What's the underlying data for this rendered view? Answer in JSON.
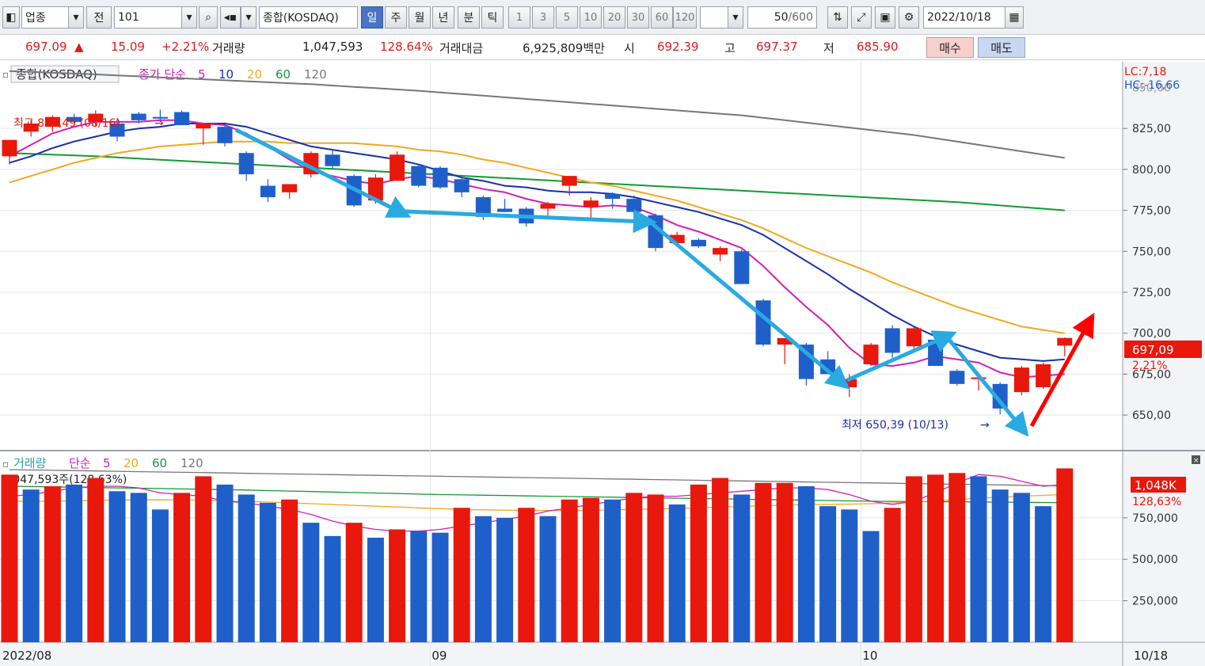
{
  "toolbar": {
    "category": "업종",
    "prev_label": "전",
    "code": "101",
    "index_name": "종합(KOSDAQ)",
    "period_tabs": [
      "일",
      "주",
      "월",
      "년",
      "분",
      "틱"
    ],
    "active_tab": "일",
    "intervals": [
      "1",
      "3",
      "5",
      "10",
      "20",
      "30",
      "60",
      "120"
    ],
    "count": "50",
    "count_max": "/600",
    "date": "2022/10/18"
  },
  "info": {
    "price": "697.09",
    "change_arrow": "▲",
    "change": "15.09",
    "change_pct": "+2.21%",
    "volume_label": "거래량",
    "volume": "1,047,593",
    "volume_pct": "128.64%",
    "amount_label": "거래대금",
    "amount": "6,925,809백만",
    "open_label": "시",
    "open": "692.39",
    "high_label": "고",
    "high": "697.37",
    "low_label": "저",
    "low": "685.90",
    "buy_label": "매수",
    "sell_label": "매도"
  },
  "chart_data": [
    {
      "type": "candlestick",
      "title": "종합(KOSDAQ)",
      "legend": {
        "prefix": "종가 단순",
        "periods": [
          "5",
          "10",
          "20",
          "60",
          "120"
        ],
        "colors": [
          "#d21fb4",
          "#1a2fa8",
          "#f0a91e",
          "#139a35",
          "#777777"
        ]
      },
      "ylim": [
        637,
        857
      ],
      "y_ticks": [
        "825,00",
        "800,00",
        "775,00",
        "750,00",
        "725,00",
        "700,00",
        "675,00",
        "650,00"
      ],
      "y_tick_values": [
        825,
        800,
        775,
        750,
        725,
        700,
        675,
        650
      ],
      "top_tick_partial": "850,00",
      "x_labels": [
        {
          "label": "2022/08",
          "index": 0
        },
        {
          "label": "09",
          "index": 20
        },
        {
          "label": "10",
          "index": 40
        }
      ],
      "last_date_label": "10/18",
      "lc": "LC:7,18",
      "hc": "HC:-16,66",
      "price_tag": "697,09",
      "pct_tag": "2,21%",
      "high_annotation": "최고 836,49 (08/16)",
      "low_annotation": "최저 650,39 (10/13)",
      "candles": [
        {
          "o": 808,
          "h": 811,
          "l": 803,
          "c": 818,
          "up": true
        },
        {
          "o": 823,
          "h": 830,
          "l": 820,
          "c": 828,
          "up": true
        },
        {
          "o": 826,
          "h": 833,
          "l": 823,
          "c": 832,
          "up": true
        },
        {
          "o": 832,
          "h": 834,
          "l": 829,
          "c": 829,
          "up": false
        },
        {
          "o": 829,
          "h": 836,
          "l": 826,
          "c": 834,
          "up": true
        },
        {
          "o": 828,
          "h": 831,
          "l": 817,
          "c": 820,
          "up": false
        },
        {
          "o": 834,
          "h": 835,
          "l": 828,
          "c": 830,
          "up": false
        },
        {
          "o": 832,
          "h": 836.5,
          "l": 829,
          "c": 831,
          "up": false
        },
        {
          "o": 835,
          "h": 836,
          "l": 827,
          "c": 827,
          "up": false
        },
        {
          "o": 825,
          "h": 828,
          "l": 815,
          "c": 828,
          "up": true
        },
        {
          "o": 826,
          "h": 827,
          "l": 814,
          "c": 816,
          "up": false
        },
        {
          "o": 810,
          "h": 811,
          "l": 793,
          "c": 797,
          "up": false
        },
        {
          "o": 790,
          "h": 794,
          "l": 780,
          "c": 783,
          "up": false
        },
        {
          "o": 786,
          "h": 791,
          "l": 782,
          "c": 791,
          "up": true
        },
        {
          "o": 797,
          "h": 811,
          "l": 795,
          "c": 810,
          "up": true
        },
        {
          "o": 809,
          "h": 812,
          "l": 800,
          "c": 802,
          "up": false
        },
        {
          "o": 796,
          "h": 797,
          "l": 777,
          "c": 778,
          "up": false
        },
        {
          "o": 781,
          "h": 797,
          "l": 779,
          "c": 795,
          "up": true
        },
        {
          "o": 793,
          "h": 811,
          "l": 793,
          "c": 809,
          "up": true
        },
        {
          "o": 802,
          "h": 803,
          "l": 789,
          "c": 790,
          "up": false
        },
        {
          "o": 801,
          "h": 802,
          "l": 788,
          "c": 789,
          "up": false
        },
        {
          "o": 794,
          "h": 795,
          "l": 783,
          "c": 786,
          "up": false
        },
        {
          "o": 783,
          "h": 784,
          "l": 769,
          "c": 771,
          "up": false
        },
        {
          "o": 776,
          "h": 782,
          "l": 774,
          "c": 774,
          "up": false
        },
        {
          "o": 776,
          "h": 777,
          "l": 765,
          "c": 767,
          "up": false
        },
        {
          "o": 776,
          "h": 780,
          "l": 770,
          "c": 779,
          "up": true
        },
        {
          "o": 790,
          "h": 791,
          "l": 784,
          "c": 796,
          "up": true
        },
        {
          "o": 777,
          "h": 783,
          "l": 769,
          "c": 781,
          "up": true
        },
        {
          "o": 782,
          "h": 786,
          "l": 776,
          "c": 785,
          "up": false
        },
        {
          "o": 782,
          "h": 784,
          "l": 770,
          "c": 774,
          "up": false
        },
        {
          "o": 772,
          "h": 773,
          "l": 750,
          "c": 752,
          "up": false
        },
        {
          "o": 760,
          "h": 762,
          "l": 755,
          "c": 755,
          "up": true
        },
        {
          "o": 757,
          "h": 758,
          "l": 752,
          "c": 753,
          "up": false
        },
        {
          "o": 748,
          "h": 753,
          "l": 744,
          "c": 752,
          "up": true
        },
        {
          "o": 750,
          "h": 751,
          "l": 730,
          "c": 730,
          "up": false
        },
        {
          "o": 720,
          "h": 721,
          "l": 692,
          "c": 693,
          "up": false
        },
        {
          "o": 693,
          "h": 697,
          "l": 681,
          "c": 697,
          "up": true
        },
        {
          "o": 693,
          "h": 694,
          "l": 668,
          "c": 672,
          "up": false
        },
        {
          "o": 684,
          "h": 689,
          "l": 675,
          "c": 675,
          "up": false
        },
        {
          "o": 667,
          "h": 675,
          "l": 661,
          "c": 672,
          "up": true
        },
        {
          "o": 681,
          "h": 694,
          "l": 680,
          "c": 693,
          "up": true
        },
        {
          "o": 703,
          "h": 705,
          "l": 685,
          "c": 688,
          "up": false
        },
        {
          "o": 692,
          "h": 704,
          "l": 688,
          "c": 703,
          "up": true
        },
        {
          "o": 696,
          "h": 697,
          "l": 680,
          "c": 680,
          "up": false
        },
        {
          "o": 677,
          "h": 678,
          "l": 668,
          "c": 669,
          "up": false
        },
        {
          "o": 672,
          "h": 675,
          "l": 665,
          "c": 673,
          "up": true
        },
        {
          "o": 669,
          "h": 670,
          "l": 650.4,
          "c": 654,
          "up": false
        },
        {
          "o": 664,
          "h": 680,
          "l": 662,
          "c": 679,
          "up": true
        },
        {
          "o": 667,
          "h": 682,
          "l": 666,
          "c": 681,
          "up": true
        },
        {
          "o": 692.39,
          "h": 697.37,
          "l": 685.9,
          "c": 697.09,
          "up": true
        }
      ],
      "ma5": [
        808,
        815,
        822,
        826,
        829,
        829,
        829,
        830,
        830,
        828,
        827,
        822,
        814,
        806,
        799,
        796,
        793,
        791,
        794,
        796,
        794,
        791,
        788,
        786,
        782,
        779,
        778,
        777,
        778,
        777,
        772,
        766,
        762,
        757,
        752,
        741,
        728,
        716,
        705,
        691,
        681,
        680,
        682,
        686,
        684,
        682,
        676,
        673,
        674,
        675
      ],
      "ma10": [
        804,
        808,
        813,
        817,
        820,
        823,
        825,
        826,
        828,
        828,
        828,
        826,
        822,
        818,
        814,
        812,
        810,
        808,
        806,
        803,
        799,
        795,
        793,
        790,
        789,
        787,
        786,
        786,
        785,
        783,
        780,
        777,
        774,
        770,
        766,
        760,
        752,
        744,
        736,
        727,
        719,
        711,
        704,
        698,
        693,
        689,
        685,
        684,
        683,
        684
      ],
      "ma20": [
        792,
        796,
        800,
        804,
        807,
        810,
        812,
        814,
        815,
        816,
        817,
        817,
        817,
        816,
        816,
        816,
        816,
        815,
        814,
        812,
        811,
        809,
        806,
        804,
        801,
        798,
        795,
        792,
        790,
        787,
        784,
        781,
        777,
        773,
        769,
        764,
        758,
        752,
        747,
        742,
        737,
        731,
        726,
        721,
        716,
        712,
        708,
        704,
        702,
        700
      ],
      "ma60": [
        810,
        809.5,
        809,
        808.5,
        808,
        807.3,
        806.6,
        805.9,
        805.2,
        804.5,
        803.8,
        803.1,
        802.4,
        801.7,
        801,
        800.3,
        799.6,
        798.9,
        798.2,
        797.5,
        796.8,
        796.1,
        795.4,
        794.7,
        794,
        793.3,
        792.6,
        791.9,
        791.2,
        790.5,
        789.8,
        789.1,
        788.4,
        787.7,
        787,
        786.3,
        785.6,
        784.9,
        784.2,
        783.5,
        782.8,
        782.1,
        781.4,
        780.7,
        780,
        779,
        778,
        777,
        776,
        775
      ],
      "ma120": [
        860,
        859.5,
        859,
        858.5,
        858,
        857.4,
        856.8,
        856.2,
        855.6,
        855,
        854.4,
        853.8,
        853.2,
        852.6,
        852,
        851.2,
        850.4,
        849.6,
        848.8,
        848,
        847,
        846,
        845,
        844,
        843,
        842,
        841,
        840,
        839,
        838,
        837,
        836,
        835,
        834,
        833,
        831.5,
        830,
        828.5,
        827,
        825.5,
        824,
        822.5,
        821,
        819,
        817,
        815,
        813,
        811,
        809,
        807
      ]
    },
    {
      "type": "bar",
      "title": "거래량",
      "legend": {
        "prefix": "단순",
        "periods": [
          "5",
          "20",
          "60",
          "120"
        ],
        "colors": [
          "#d21fb4",
          "#f0a91e",
          "#139a35",
          "#777777"
        ]
      },
      "current_label": "1,047,593주(128,63%)",
      "ylim": [
        0,
        1150000
      ],
      "y_ticks": [
        "750,000",
        "500,000",
        "250,000"
      ],
      "y_tick_values": [
        750000,
        500000,
        250000
      ],
      "vol_tag": "1,048K",
      "vol_pct_tag": "128,63%",
      "values": [
        1010000,
        920000,
        940000,
        950000,
        990000,
        910000,
        900000,
        800000,
        900000,
        1000000,
        950000,
        890000,
        840000,
        860000,
        720000,
        640000,
        720000,
        630000,
        680000,
        670000,
        660000,
        810000,
        760000,
        750000,
        810000,
        760000,
        860000,
        870000,
        860000,
        900000,
        890000,
        830000,
        950000,
        990000,
        890000,
        960000,
        960000,
        940000,
        820000,
        800000,
        670000,
        810000,
        1000000,
        1010000,
        1020000,
        1000000,
        920000,
        900000,
        820000,
        1047593
      ],
      "up": [
        true,
        false,
        true,
        false,
        true,
        false,
        false,
        false,
        true,
        true,
        false,
        false,
        false,
        true,
        false,
        false,
        true,
        false,
        true,
        false,
        false,
        true,
        false,
        false,
        true,
        false,
        true,
        true,
        false,
        true,
        true,
        false,
        true,
        true,
        false,
        true,
        true,
        false,
        false,
        false,
        false,
        true,
        true,
        true,
        true,
        false,
        false,
        false,
        false,
        true
      ],
      "ma5": [
        880000,
        890000,
        910000,
        930000,
        940000,
        940000,
        930000,
        900000,
        890000,
        880000,
        850000,
        840000,
        820000,
        800000,
        770000,
        730000,
        700000,
        680000,
        670000,
        670000,
        680000,
        700000,
        720000,
        740000,
        760000,
        790000,
        810000,
        830000,
        850000,
        870000,
        880000,
        880000,
        890000,
        900000,
        910000,
        920000,
        930000,
        930000,
        920000,
        890000,
        850000,
        830000,
        850000,
        900000,
        960000,
        1010000,
        1000000,
        970000,
        940000,
        950000
      ],
      "ma20": [
        850000,
        850000,
        850000,
        852000,
        855000,
        857000,
        858000,
        858000,
        857000,
        855000,
        852000,
        848000,
        845000,
        840000,
        835000,
        830000,
        825000,
        820000,
        815000,
        810000,
        805000,
        800000,
        798000,
        796000,
        795000,
        794000,
        794000,
        795000,
        797000,
        800000,
        803000,
        806000,
        810000,
        815000,
        818000,
        822000,
        826000,
        830000,
        830000,
        832000,
        835000,
        840000,
        845000,
        852000,
        860000,
        868000,
        874000,
        880000,
        885000,
        890000
      ],
      "ma60": [
        940000,
        938000,
        936000,
        934000,
        932000,
        930000,
        928000,
        926000,
        924000,
        922000,
        920000,
        917000,
        914000,
        911000,
        908000,
        905000,
        902000,
        899000,
        896000,
        893000,
        890000,
        888000,
        886000,
        884000,
        882000,
        880000,
        878000,
        876000,
        874000,
        872000,
        870000,
        868000,
        866000,
        864000,
        862000,
        860000,
        858000,
        856000,
        854000,
        852000,
        850000,
        849000,
        848000,
        847000,
        846000,
        845000,
        844000,
        843000,
        842000,
        841000
      ],
      "ma120": [
        1040000,
        1038000,
        1036000,
        1034000,
        1032000,
        1030000,
        1028000,
        1026000,
        1024000,
        1022000,
        1020000,
        1018000,
        1016000,
        1014000,
        1012000,
        1010000,
        1008000,
        1006000,
        1004000,
        1002000,
        1000000,
        998000,
        996000,
        994000,
        992000,
        990000,
        988000,
        986000,
        984000,
        982000,
        980000,
        978000,
        976000,
        974000,
        972000,
        970000,
        968000,
        966000,
        964000,
        962000,
        960000,
        958000,
        956000,
        954000,
        952000,
        950000,
        948000,
        946000,
        944000,
        942000
      ]
    }
  ],
  "colors": {
    "up": "#e8180c",
    "down": "#1f5fc9",
    "annotation_arrow": "#29aae1",
    "up_arrow": "#ff0000"
  }
}
